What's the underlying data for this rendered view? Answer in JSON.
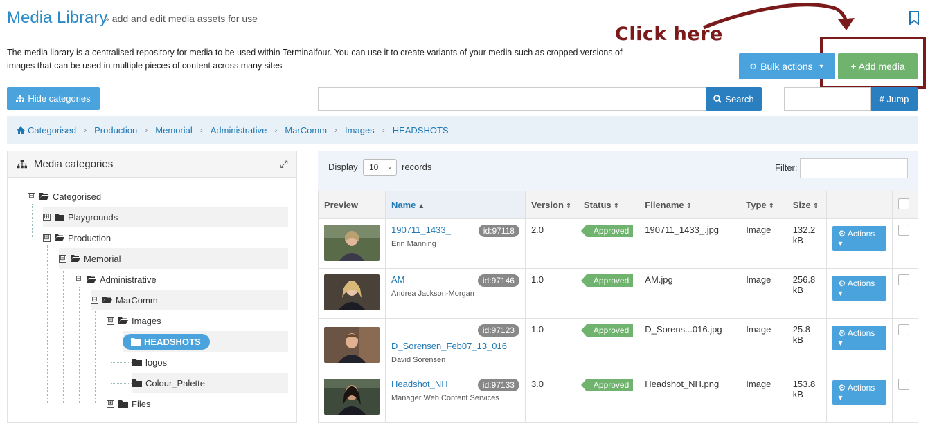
{
  "header": {
    "title": "Media Library",
    "subtitle_sep": "»",
    "subtitle": "add and edit media assets for use"
  },
  "annotation": {
    "text": "Click here",
    "color": "#7a1a1a"
  },
  "intro": "The media library is a centralised repository for media to be used within Terminalfour. You can use it to create variants of your media such as cropped versions of images that can be used in multiple pieces of content across many sites",
  "toolbar": {
    "bulk_label": "Bulk actions",
    "add_label": "+ Add media",
    "hide_categories_label": "Hide categories",
    "search_label": "Search",
    "search_value": "",
    "jump_label": "# Jump",
    "jump_value": ""
  },
  "breadcrumb": [
    "Categorised",
    "Production",
    "Memorial",
    "Administrative",
    "MarComm",
    "Images",
    "HEADSHOTS"
  ],
  "categories": {
    "title": "Media categories",
    "tree": [
      {
        "label": "Categorised",
        "toggle": "⊟"
      },
      {
        "label": "Playgrounds",
        "toggle": "⊞"
      },
      {
        "label": "Production",
        "toggle": "⊟"
      },
      {
        "label": "Memorial",
        "toggle": "⊟"
      },
      {
        "label": "Administrative",
        "toggle": "⊟"
      },
      {
        "label": "MarComm",
        "toggle": "⊟"
      },
      {
        "label": "Images",
        "toggle": "⊟"
      },
      {
        "label": "HEADSHOTS",
        "toggle": ""
      },
      {
        "label": "logos",
        "toggle": ""
      },
      {
        "label": "Colour_Palette",
        "toggle": ""
      },
      {
        "label": "Files",
        "toggle": "⊞"
      }
    ]
  },
  "table": {
    "display_label": "Display",
    "display_value": "10",
    "records_label": "records",
    "filter_label": "Filter:",
    "filter_value": "",
    "columns": [
      "Preview",
      "Name",
      "Version",
      "Status",
      "Filename",
      "Type",
      "Size"
    ],
    "sort_up": "▲",
    "sort_both": "⇕",
    "actions_label": "Actions",
    "rows": [
      {
        "name": "190711_1433_",
        "sub": "Erin Manning",
        "id": "id:97118",
        "version": "2.0",
        "status": "Approved",
        "filename": "190711_1433_.jpg",
        "type": "Image",
        "size": "132.2 kB"
      },
      {
        "name": "AM",
        "sub": "Andrea Jackson-Morgan",
        "id": "id:97146",
        "version": "1.0",
        "status": "Approved",
        "filename": "AM.jpg",
        "type": "Image",
        "size": "256.8 kB"
      },
      {
        "name": "D_Sorensen_Feb07_13_016",
        "sub": "David Sorensen",
        "id": "id:97123",
        "version": "1.0",
        "status": "Approved",
        "filename": "D_Sorens...016.jpg",
        "type": "Image",
        "size": "25.8 kB"
      },
      {
        "name": "Headshot_NH",
        "sub": "Manager Web Content Services",
        "id": "id:97133",
        "version": "3.0",
        "status": "Approved",
        "filename": "Headshot_NH.png",
        "type": "Image",
        "size": "153.8 kB"
      }
    ]
  },
  "colors": {
    "primary": "#2a8bc7",
    "success": "#6fb36f",
    "accent": "#4aa3dd"
  }
}
